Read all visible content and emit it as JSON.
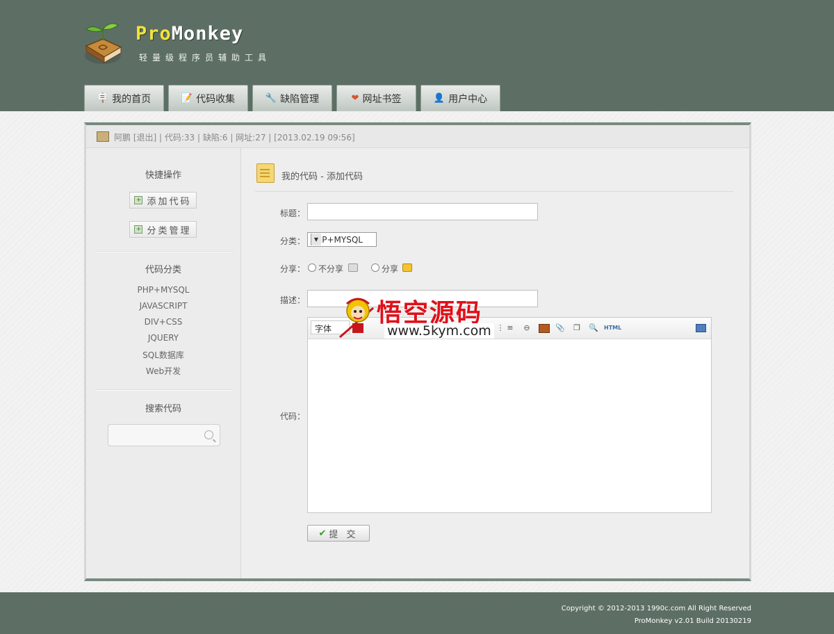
{
  "header": {
    "brand_part1": "Pro",
    "brand_part2": "Monkey",
    "tagline": "轻量级程序员辅助工具"
  },
  "nav": {
    "tabs": [
      {
        "label": "我的首页",
        "icon": "signpost-icon"
      },
      {
        "label": "代码收集",
        "icon": "notepad-icon"
      },
      {
        "label": "缺陷管理",
        "icon": "wrench-icon"
      },
      {
        "label": "网址书签",
        "icon": "heart-icon"
      },
      {
        "label": "用户中心",
        "icon": "user-icon"
      }
    ]
  },
  "userbar": {
    "text": "阿鹏 [退出] | 代码:33 | 缺陷:6 | 网址:27 | [2013.02.19 09:56]"
  },
  "sidebar": {
    "quick_title": "快捷操作",
    "add_code": "添加代码",
    "category_manage": "分类管理",
    "category_title": "代码分类",
    "categories": [
      "PHP+MYSQL",
      "JAVASCRIPT",
      "DIV+CSS",
      "JQUERY",
      "SQL数据库",
      "Web开发"
    ],
    "search_title": "搜索代码",
    "search_value": ""
  },
  "content": {
    "page_title": "我的代码 - 添加代码",
    "form": {
      "title_label": "标题：",
      "title_value": "",
      "category_label": "分类：",
      "category_value": "PHP+MYSQL",
      "share_label": "分享：",
      "share_no": "不分享",
      "share_yes": "分享",
      "desc_label": "描述：",
      "desc_value": "",
      "code_label": "代码：",
      "font_select": "字体",
      "toolbar_html": "HTML",
      "submit": "提 交"
    }
  },
  "watermark": {
    "text": "悟空源码",
    "url": "www.5kym.com"
  },
  "footer": {
    "copyright": "Copyright © 2012-2013 1990c.com All Right Reserved",
    "version": "ProMonkey v2.01 Build 20130219"
  },
  "colors": {
    "header_bg": "#5d6f64",
    "brand_yellow": "#f2e33a",
    "panel_border": "#778a7f"
  }
}
